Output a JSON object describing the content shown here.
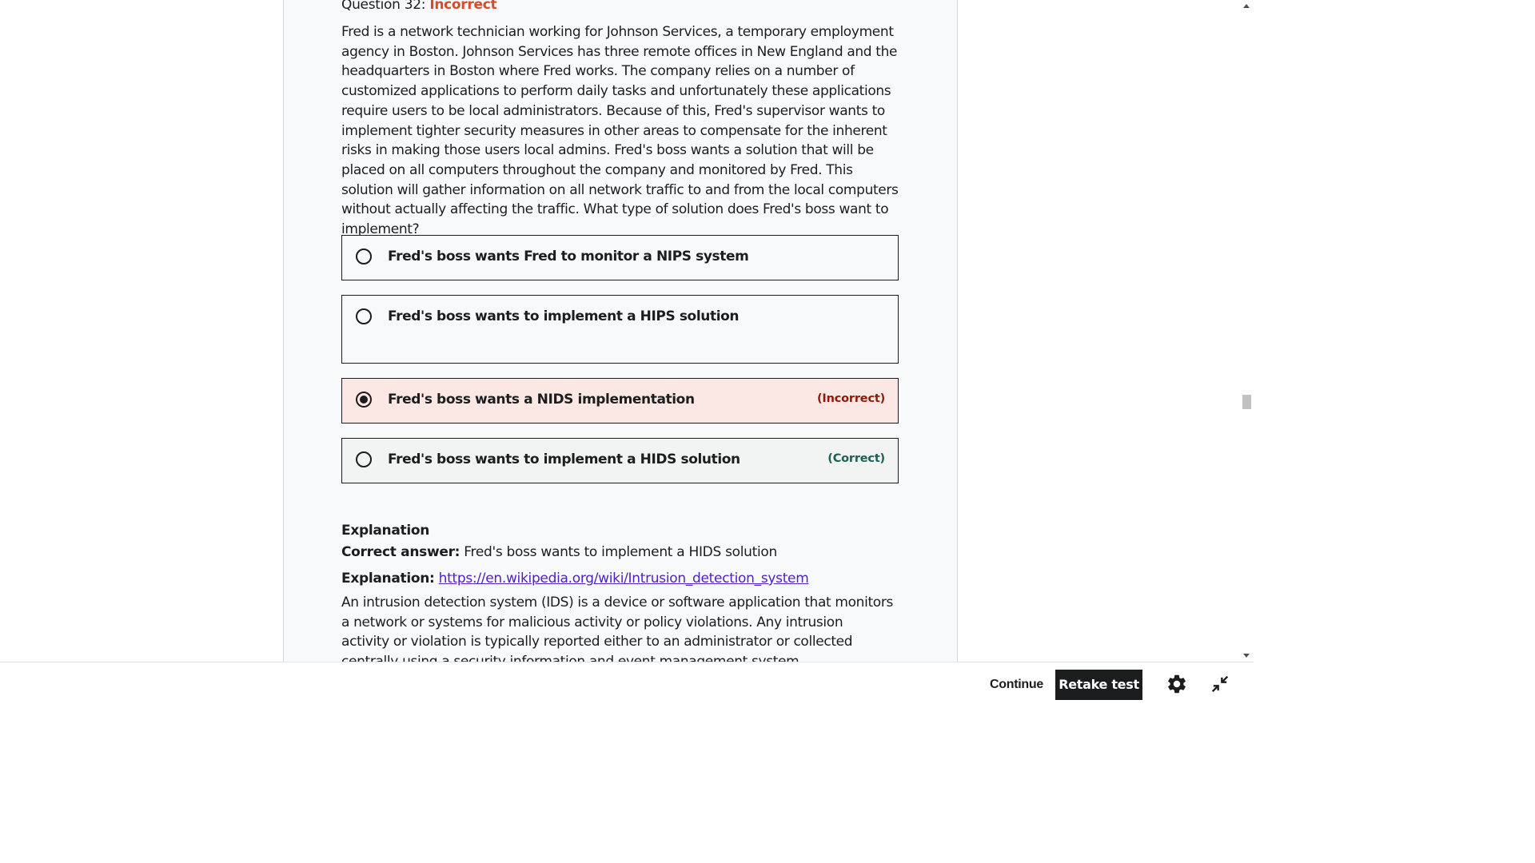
{
  "question": {
    "heading_prefix": "Question 32:",
    "status": "Incorrect",
    "text": "Fred is a network technician working for Johnson Services, a temporary employment agency in Boston. Johnson Services has three remote offices in New England and the headquarters in Boston where Fred works. The company relies on a number of customized applications to perform daily tasks and unfortunately these applications require users to be local administrators. Because of this, Fred's supervisor wants to implement tighter security measures in other areas to compensate for the inherent risks in making those users local admins. Fred's boss wants a solution that will be placed on all computers throughout the company and monitored by Fred. This solution will gather information on all network traffic to and from the local computers without actually affecting the traffic. What type of solution does Fred's boss want to implement?"
  },
  "answers": [
    {
      "label": "Fred's boss wants Fred to monitor a NIPS system",
      "selected": false,
      "tag": ""
    },
    {
      "label": "Fred's boss wants to implement a HIPS solution",
      "selected": false,
      "tag": ""
    },
    {
      "label": "Fred's boss wants a NIDS implementation",
      "selected": true,
      "tag": "(Incorrect)"
    },
    {
      "label": "Fred's boss wants to implement a HIDS solution",
      "selected": false,
      "tag": "(Correct)"
    }
  ],
  "explanation": {
    "title": "Explanation",
    "correct_label": "Correct answer:",
    "correct_value": "Fred's boss wants to implement a HIDS solution",
    "expl_label": "Explanation:",
    "link": "https://en.wikipedia.org/wiki/Intrusion_detection_system",
    "body": "An intrusion detection system (IDS) is a device or software application that monitors a network or systems for malicious activity or policy violations. Any intrusion activity or violation is typically reported either to an administrator or collected centrally using a security information and event management system."
  },
  "footer": {
    "continue_label": "Continue",
    "retake_label": "Retake test",
    "settings_icon": "gear-icon",
    "collapse_icon": "collapse-icon"
  },
  "colors": {
    "incorrect_status": "#d44d2b",
    "incorrect_bg": "#fbe8e4",
    "incorrect_tag": "#8f1a0a",
    "correct_tag": "#1e6055",
    "link": "#5022c3",
    "primary_button": "#1c1d1f"
  }
}
